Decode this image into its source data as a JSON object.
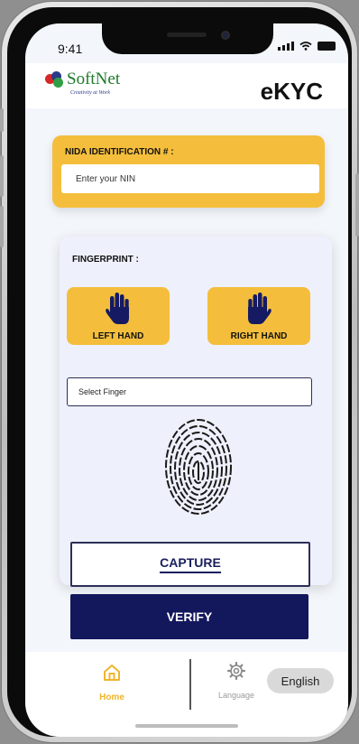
{
  "status_bar": {
    "time": "9:41"
  },
  "header": {
    "logo_text": "SoftNet",
    "tagline": "Creativity at Work",
    "title": "eKYC"
  },
  "nida": {
    "label": "NIDA IDENTIFICATION # :",
    "placeholder": "Enter your NIN",
    "value": ""
  },
  "fingerprint": {
    "label": "FINGERPRINT :",
    "left_hand_label": "LEFT HAND",
    "right_hand_label": "RIGHT HAND",
    "select_placeholder": "Select Finger",
    "capture_label": "CAPTURE"
  },
  "verify_label": "VERIFY",
  "bottom_nav": {
    "home_label": "Home",
    "language_label": "Language",
    "language_value": "English"
  },
  "icons": {
    "hand": "hand-icon",
    "home": "home-icon",
    "settings": "gear-icon",
    "fingerprint": "fingerprint-icon"
  },
  "colors": {
    "accent_yellow": "#f4be3c",
    "navy": "#13175c",
    "hand_blue": "#151a63",
    "home_active": "#f0b52d"
  }
}
